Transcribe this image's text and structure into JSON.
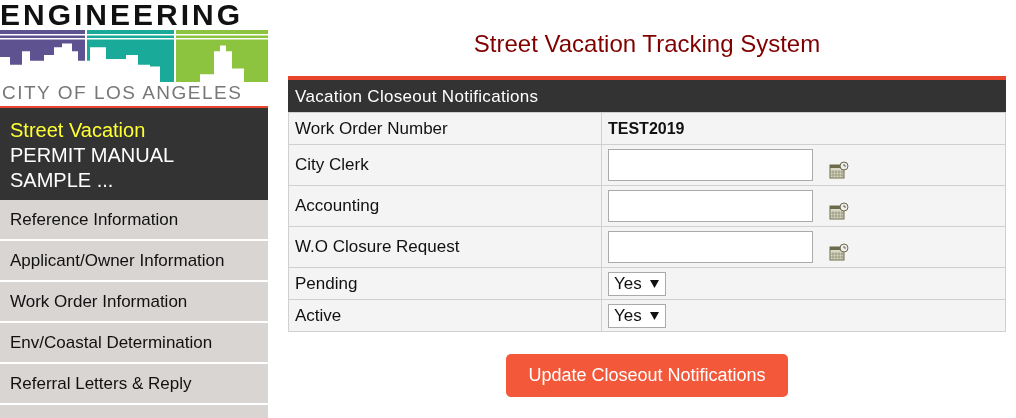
{
  "logo": {
    "title": "ENGINEERING",
    "subtitle": "CITY OF LOS ANGELES"
  },
  "sidebar": {
    "heading": "Street Vacation",
    "subheading": "PERMIT MANUAL SAMPLE ...",
    "items": [
      {
        "label": "Reference Information"
      },
      {
        "label": "Applicant/Owner Information"
      },
      {
        "label": "Work Order Information"
      },
      {
        "label": "Env/Coastal Determination"
      },
      {
        "label": "Referral Letters & Reply"
      }
    ]
  },
  "page_title": "Street Vacation Tracking System",
  "panel": {
    "title": "Vacation Closeout Notifications",
    "rows": [
      {
        "label": "Work Order Number",
        "kind": "text",
        "value": "TEST2019"
      },
      {
        "label": "City Clerk",
        "kind": "date"
      },
      {
        "label": "Accounting",
        "kind": "date"
      },
      {
        "label": "W.O Closure Request",
        "kind": "date"
      },
      {
        "label": "Pending",
        "kind": "select",
        "value": "Yes"
      },
      {
        "label": "Active",
        "kind": "select",
        "value": "Yes"
      }
    ]
  },
  "button": "Update Closeout Notifications"
}
